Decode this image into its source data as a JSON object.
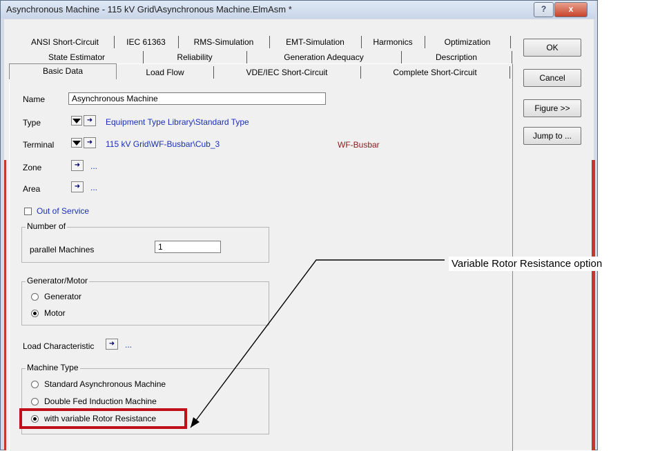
{
  "window": {
    "title": "Asynchronous Machine - 115 kV Grid\\Asynchronous Machine.ElmAsm *",
    "help_label": "?",
    "close_label": "x"
  },
  "tabs": {
    "row1": [
      "ANSI Short-Circuit",
      "IEC 61363",
      "RMS-Simulation",
      "EMT-Simulation",
      "Harmonics",
      "Optimization"
    ],
    "row2": [
      "State Estimator",
      "Reliability",
      "Generation Adequacy",
      "Description"
    ],
    "row3": [
      "Basic Data",
      "Load Flow",
      "VDE/IEC Short-Circuit",
      "Complete Short-Circuit"
    ],
    "active": "Basic Data"
  },
  "buttons": {
    "ok": "OK",
    "cancel": "Cancel",
    "figure": "Figure >>",
    "jump": "Jump to ..."
  },
  "form": {
    "name_label": "Name",
    "name_value": "Asynchronous Machine",
    "type_label": "Type",
    "type_value": "Equipment Type Library\\Standard Type",
    "terminal_label": "Terminal",
    "terminal_value": "115 kV Grid\\WF-Busbar\\Cub_3",
    "terminal_busbar": "WF-Busbar",
    "zone_label": "Zone",
    "zone_value": "...",
    "area_label": "Area",
    "area_value": "...",
    "out_of_service_label": "Out of Service",
    "out_of_service_checked": false
  },
  "number_of": {
    "legend": "Number of",
    "parallel_label": "parallel Machines",
    "parallel_value": "1"
  },
  "gen_motor": {
    "legend": "Generator/Motor",
    "options": [
      "Generator",
      "Motor"
    ],
    "selected": "Motor"
  },
  "load_characteristic": {
    "label": "Load Characteristic",
    "value": "..."
  },
  "machine_type": {
    "legend": "Machine Type",
    "options": [
      "Standard Asynchronous Machine",
      "Double Fed Induction Machine",
      "with variable Rotor Resistance"
    ],
    "selected": "with variable Rotor Resistance"
  },
  "annotation": {
    "text": "Variable Rotor Resistance option",
    "highlight_color": "#c0101a"
  },
  "colors": {
    "link": "#1a2fb5",
    "busbar": "#8b1a1a",
    "accent_red": "#c0392b"
  }
}
